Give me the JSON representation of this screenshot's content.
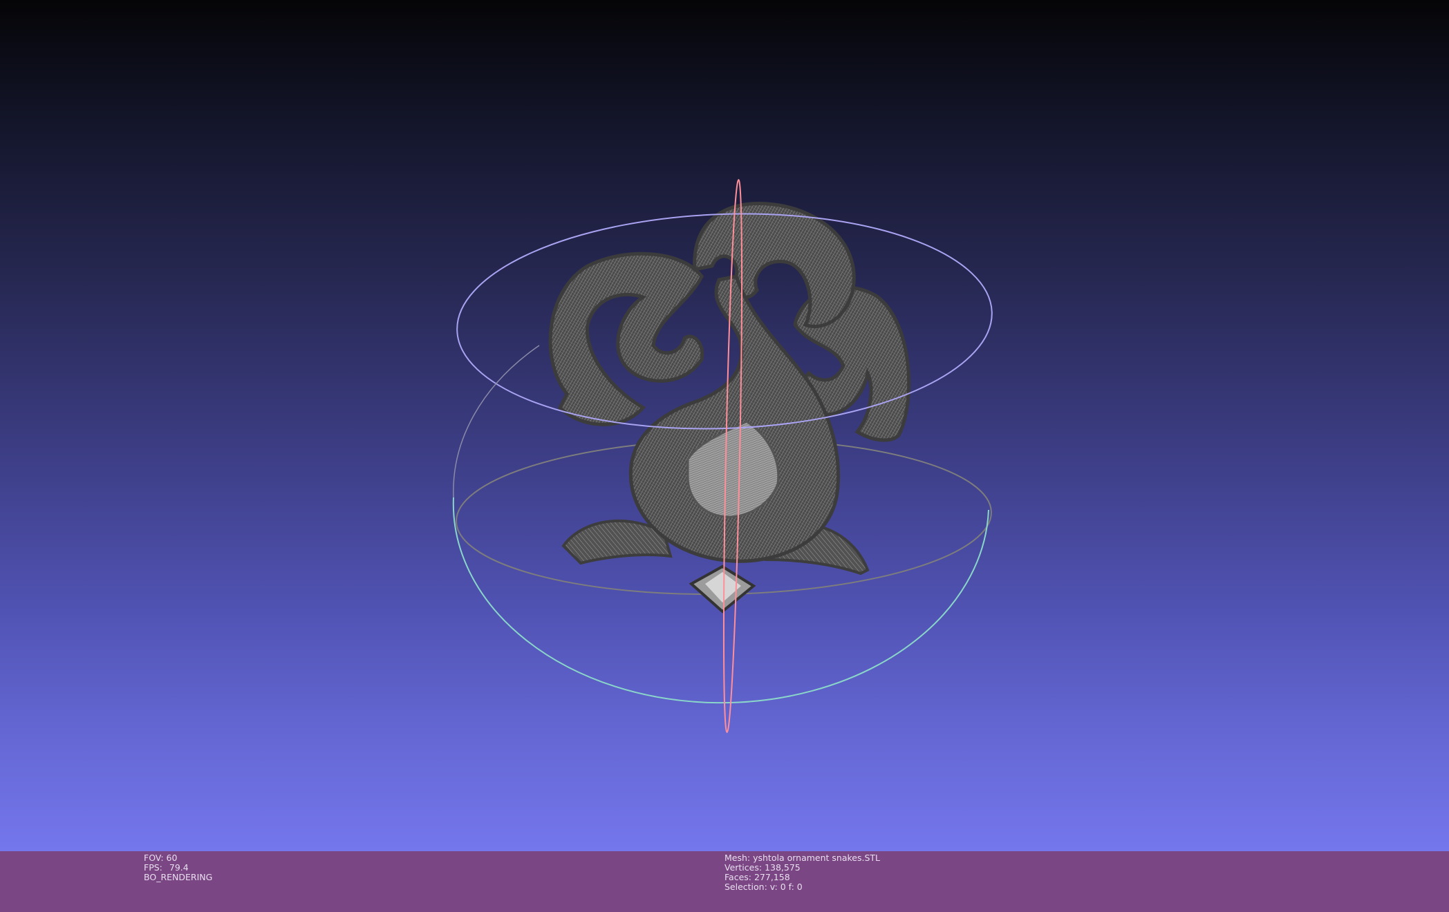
{
  "viewport": {
    "render_mode": "wireframe",
    "model_color": "#4a4a4a",
    "trackball_colors": {
      "horizontal_ring": "#8ad6c9",
      "vertical_ring_front": "#a9a3f2",
      "vertical_ring_back": "#7a7a7a",
      "axis_ring": "#ff8f9a"
    }
  },
  "status_left": {
    "fov_label": "FOV:",
    "fov_value": "60",
    "fps_label": "FPS:",
    "fps_value": "79.4",
    "render_mode_label": "BO_RENDERING"
  },
  "status_center": {
    "mesh_line": "Mesh: yshtola ornament snakes.STL",
    "vertices_line": "Vertices: 138,575",
    "faces_line": "Faces: 277,158",
    "selection_line": "Selection: v: 0 f: 0"
  },
  "colors": {
    "statusbar_bg": "#7a4683",
    "statusbar_text": "#e9dff0",
    "gradient_top": "#050507",
    "gradient_bottom": "#7476ec"
  }
}
